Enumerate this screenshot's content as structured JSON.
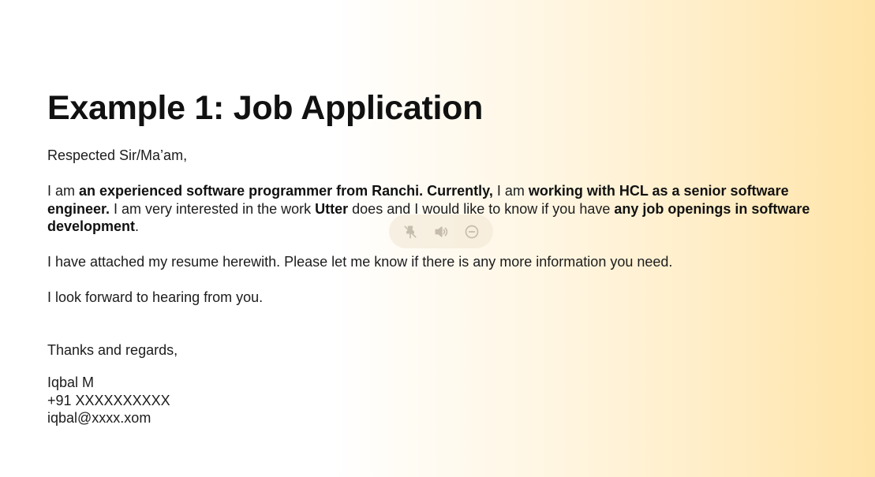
{
  "heading": "Example 1: Job Application",
  "salutation": "Respected Sir/Ma’am,",
  "para1": {
    "t1": "I am ",
    "b1": "an experienced software programmer from Ranchi. Currently,",
    "t2": " I am ",
    "b2": "working with HCL as a senior software engineer.",
    "t3": " I am very interested in the work ",
    "b3": "Utter",
    "t4": " does and I would like to know if you have ",
    "b4": "any job openings in software development",
    "t5": "."
  },
  "para2": "I have attached my resume herewith. Please let me know if there is any more information you need.",
  "para3": "I look forward to hearing from you.",
  "signoff": "Thanks and regards,",
  "signature": {
    "name": "Iqbal M",
    "phone": "+91 XXXXXXXXXX",
    "email": "iqbal@xxxx.xom"
  },
  "toolbar": {
    "icons": [
      "pin-off-icon",
      "speaker-icon",
      "minus-circle-icon"
    ]
  }
}
